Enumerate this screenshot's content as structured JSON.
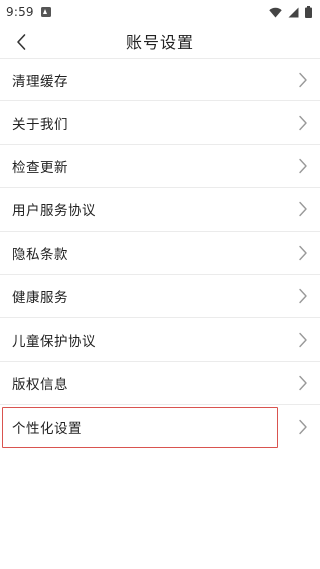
{
  "status_bar": {
    "time": "9:59",
    "icons": [
      "notification-icon",
      "wifi-icon",
      "signal-icon",
      "battery-icon"
    ]
  },
  "header": {
    "title": "账号设置",
    "back_icon": "chevron-left-icon"
  },
  "menu": {
    "items": [
      {
        "label": "清理缓存"
      },
      {
        "label": "关于我们"
      },
      {
        "label": "检查更新"
      },
      {
        "label": "用户服务协议"
      },
      {
        "label": "隐私条款"
      },
      {
        "label": "健康服务"
      },
      {
        "label": "儿童保护协议"
      },
      {
        "label": "版权信息"
      },
      {
        "label": "个性化设置"
      }
    ]
  },
  "colors": {
    "highlight_border": "#d9534f",
    "divider": "#ebebeb",
    "chevron": "#999999"
  }
}
